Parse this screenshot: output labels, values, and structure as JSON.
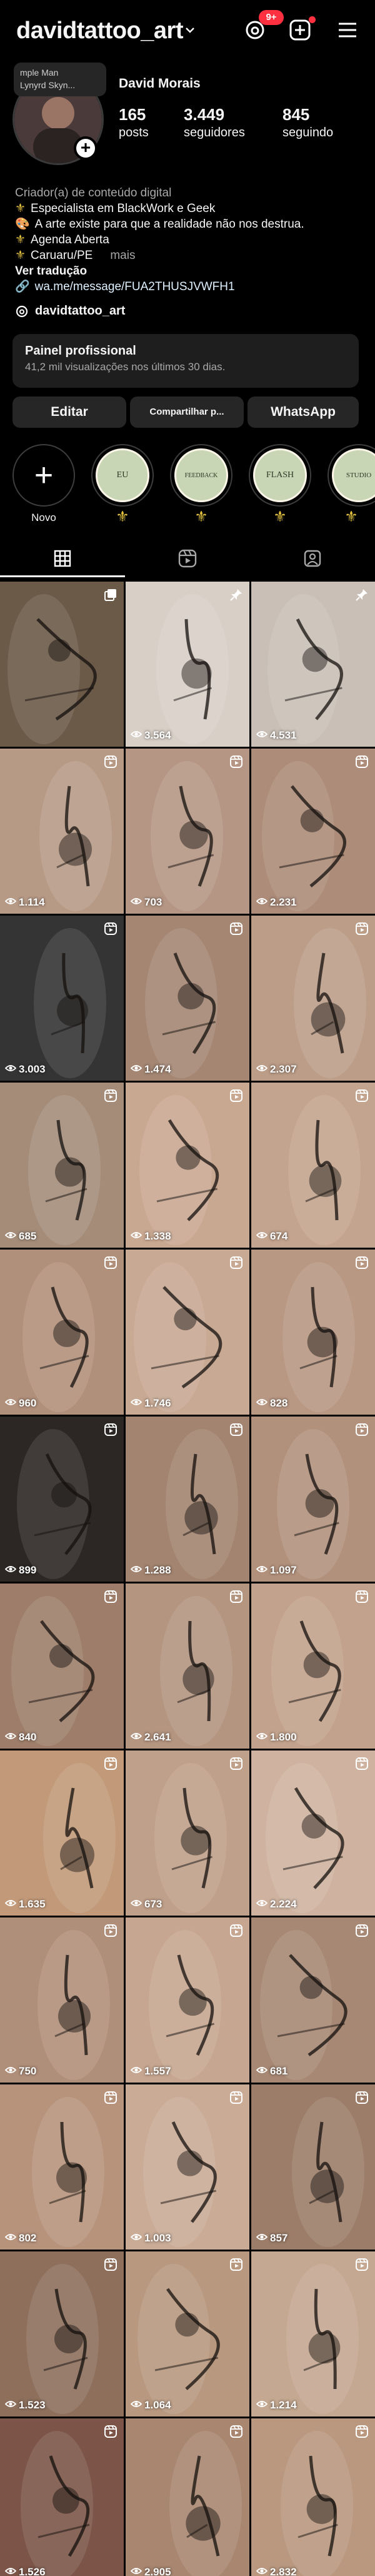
{
  "header": {
    "username": "davidtattoo_art",
    "notification_count": "9+"
  },
  "note": {
    "line1": "mple Man",
    "line2": "Lynyrd Skyn..."
  },
  "profile": {
    "display_name": "David Morais",
    "stats": [
      {
        "value": "165",
        "label": "posts"
      },
      {
        "value": "3.449",
        "label": "seguidores"
      },
      {
        "value": "845",
        "label": "seguindo"
      }
    ],
    "category": "Criador(a) de conteúdo digital",
    "bio_lines": [
      {
        "icon": "fleur",
        "text": "Especialista em BlackWork e Geek"
      },
      {
        "icon": "palette",
        "text": "A arte existe para que a realidade não nos destrua."
      },
      {
        "icon": "fleur",
        "text": "Agenda Aberta"
      },
      {
        "icon": "fleur",
        "text": "Caruaru/PE",
        "more": "mais"
      }
    ],
    "translate": "Ver tradução",
    "link": "wa.me/message/FUA2THUSJVWFH1",
    "threads_handle": "davidtattoo_art"
  },
  "dashboard": {
    "title": "Painel profissional",
    "subtitle": "41,2 mil visualizações nos últimos 30 dias."
  },
  "buttons": {
    "edit": "Editar",
    "share": "Compartilhar p...",
    "whatsapp": "WhatsApp"
  },
  "highlights": [
    {
      "label": "Novo",
      "kind": "new"
    },
    {
      "label": "",
      "cover": "EU",
      "kind": "story"
    },
    {
      "label": "",
      "cover": "FEEDBACK",
      "kind": "story"
    },
    {
      "label": "",
      "cover": "FLASH",
      "kind": "story"
    },
    {
      "label": "",
      "cover": "STUDIO",
      "kind": "story"
    }
  ],
  "tabs": [
    {
      "name": "grid",
      "icon": "grid-icon",
      "active": true
    },
    {
      "name": "reels",
      "icon": "reels-icon",
      "active": false
    },
    {
      "name": "tagged",
      "icon": "tagged-icon",
      "active": false
    }
  ],
  "posts": [
    {
      "views": "",
      "type": "pinned-carousel",
      "tone": "#6b5a48"
    },
    {
      "views": "3.564",
      "type": "pinned",
      "tone": "#d8cfc7"
    },
    {
      "views": "4.531",
      "type": "pinned",
      "tone": "#c9bfb6"
    },
    {
      "views": "1.114",
      "type": "reel",
      "tone": "#b79a86"
    },
    {
      "views": "703",
      "type": "reel",
      "tone": "#b59684"
    },
    {
      "views": "2.231",
      "type": "reel",
      "tone": "#ad8c79"
    },
    {
      "views": "3.003",
      "type": "reel",
      "tone": "#343434"
    },
    {
      "views": "1.474",
      "type": "reel",
      "tone": "#a48673"
    },
    {
      "views": "2.307",
      "type": "reel",
      "tone": "#bb9d88"
    },
    {
      "views": "685",
      "type": "reel",
      "tone": "#a48c79"
    },
    {
      "views": "1.338",
      "type": "reel",
      "tone": "#c9a892"
    },
    {
      "views": "674",
      "type": "reel",
      "tone": "#c3a48e"
    },
    {
      "views": "960",
      "type": "reel",
      "tone": "#b1907b"
    },
    {
      "views": "1.746",
      "type": "reel",
      "tone": "#c8a993"
    },
    {
      "views": "828",
      "type": "reel",
      "tone": "#b89783"
    },
    {
      "views": "899",
      "type": "reel",
      "tone": "#2c2624"
    },
    {
      "views": "1.288",
      "type": "reel",
      "tone": "#a38470"
    },
    {
      "views": "1.097",
      "type": "reel",
      "tone": "#b2917c"
    },
    {
      "views": "840",
      "type": "reel",
      "tone": "#9e7e6a"
    },
    {
      "views": "2.641",
      "type": "reel",
      "tone": "#b49580"
    },
    {
      "views": "1.800",
      "type": "reel",
      "tone": "#c2a28c"
    },
    {
      "views": "1.635",
      "type": "reel",
      "tone": "#c29a7a"
    },
    {
      "views": "673",
      "type": "reel",
      "tone": "#bfa08a"
    },
    {
      "views": "2.224",
      "type": "reel",
      "tone": "#cfb3a0"
    },
    {
      "views": "750",
      "type": "reel",
      "tone": "#b08f7a"
    },
    {
      "views": "1.557",
      "type": "reel",
      "tone": "#c6a690"
    },
    {
      "views": "681",
      "type": "reel",
      "tone": "#a78874"
    },
    {
      "views": "802",
      "type": "reel",
      "tone": "#b7937c"
    },
    {
      "views": "1.003",
      "type": "reel",
      "tone": "#c9ab96"
    },
    {
      "views": "857",
      "type": "reel",
      "tone": "#9c7d69"
    },
    {
      "views": "1.523",
      "type": "reel",
      "tone": "#8d6f5c"
    },
    {
      "views": "1.064",
      "type": "reel",
      "tone": "#b8987f"
    },
    {
      "views": "1.214",
      "type": "reel",
      "tone": "#c4a891"
    },
    {
      "views": "1.526",
      "type": "reel",
      "tone": "#7c5548"
    },
    {
      "views": "2.905",
      "type": "reel",
      "tone": "#a88670"
    },
    {
      "views": "2.832",
      "type": "reel",
      "tone": "#b9987f"
    }
  ]
}
